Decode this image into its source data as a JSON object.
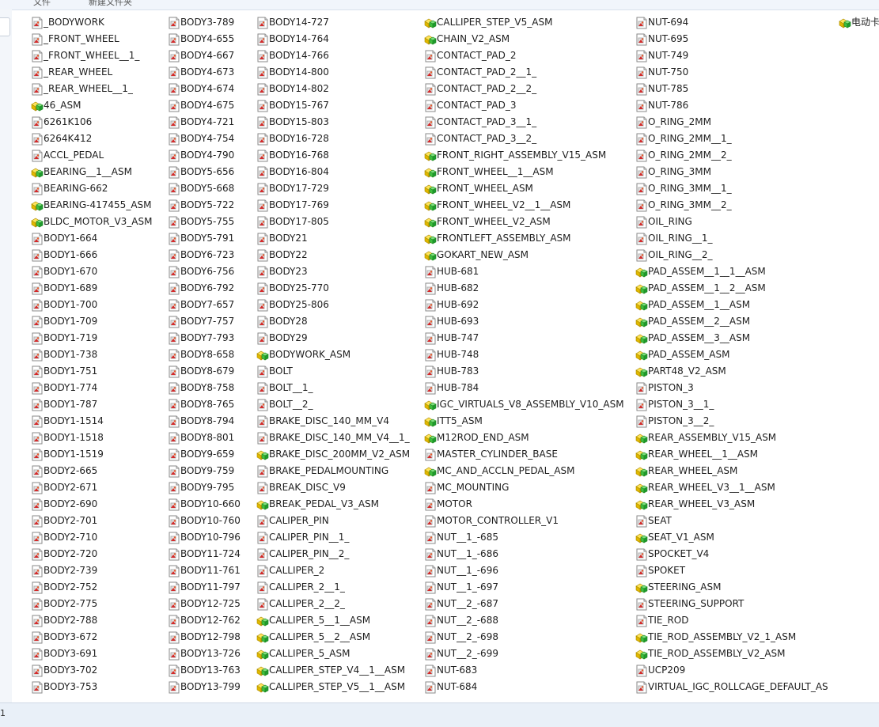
{
  "window": {
    "top_fragment_left": "文件",
    "top_fragment_right": "新建文件夹"
  },
  "status": {
    "text": "1"
  },
  "icons": {
    "part": "part-file-icon",
    "assembly": "assembly-file-icon"
  },
  "columns": [
    {
      "items": [
        {
          "name": "_BODYWORK",
          "type": "part"
        },
        {
          "name": "_FRONT_WHEEL",
          "type": "part"
        },
        {
          "name": "_FRONT_WHEEL__1_",
          "type": "part"
        },
        {
          "name": "_REAR_WHEEL",
          "type": "part"
        },
        {
          "name": "_REAR_WHEEL__1_",
          "type": "part"
        },
        {
          "name": "46_ASM",
          "type": "assembly"
        },
        {
          "name": "6261K106",
          "type": "part"
        },
        {
          "name": "6264K412",
          "type": "part"
        },
        {
          "name": "ACCL_PEDAL",
          "type": "part"
        },
        {
          "name": "BEARING__1__ASM",
          "type": "assembly"
        },
        {
          "name": "BEARING-662",
          "type": "part"
        },
        {
          "name": "BEARING-417455_ASM",
          "type": "assembly"
        },
        {
          "name": "BLDC_MOTOR_V3_ASM",
          "type": "assembly"
        },
        {
          "name": "BODY1-664",
          "type": "part"
        },
        {
          "name": "BODY1-666",
          "type": "part"
        },
        {
          "name": "BODY1-670",
          "type": "part"
        },
        {
          "name": "BODY1-689",
          "type": "part"
        },
        {
          "name": "BODY1-700",
          "type": "part"
        },
        {
          "name": "BODY1-709",
          "type": "part"
        },
        {
          "name": "BODY1-719",
          "type": "part"
        },
        {
          "name": "BODY1-738",
          "type": "part"
        },
        {
          "name": "BODY1-751",
          "type": "part"
        },
        {
          "name": "BODY1-774",
          "type": "part"
        },
        {
          "name": "BODY1-787",
          "type": "part"
        },
        {
          "name": "BODY1-1514",
          "type": "part"
        },
        {
          "name": "BODY1-1518",
          "type": "part"
        },
        {
          "name": "BODY1-1519",
          "type": "part"
        },
        {
          "name": "BODY2-665",
          "type": "part"
        },
        {
          "name": "BODY2-671",
          "type": "part"
        },
        {
          "name": "BODY2-690",
          "type": "part"
        },
        {
          "name": "BODY2-701",
          "type": "part"
        },
        {
          "name": "BODY2-710",
          "type": "part"
        },
        {
          "name": "BODY2-720",
          "type": "part"
        },
        {
          "name": "BODY2-739",
          "type": "part"
        },
        {
          "name": "BODY2-752",
          "type": "part"
        },
        {
          "name": "BODY2-775",
          "type": "part"
        },
        {
          "name": "BODY2-788",
          "type": "part"
        },
        {
          "name": "BODY3-672",
          "type": "part"
        },
        {
          "name": "BODY3-691",
          "type": "part"
        },
        {
          "name": "BODY3-702",
          "type": "part"
        },
        {
          "name": "BODY3-753",
          "type": "part"
        }
      ]
    },
    {
      "items": [
        {
          "name": "BODY3-789",
          "type": "part"
        },
        {
          "name": "BODY4-655",
          "type": "part"
        },
        {
          "name": "BODY4-667",
          "type": "part"
        },
        {
          "name": "BODY4-673",
          "type": "part"
        },
        {
          "name": "BODY4-674",
          "type": "part"
        },
        {
          "name": "BODY4-675",
          "type": "part"
        },
        {
          "name": "BODY4-721",
          "type": "part"
        },
        {
          "name": "BODY4-754",
          "type": "part"
        },
        {
          "name": "BODY4-790",
          "type": "part"
        },
        {
          "name": "BODY5-656",
          "type": "part"
        },
        {
          "name": "BODY5-668",
          "type": "part"
        },
        {
          "name": "BODY5-722",
          "type": "part"
        },
        {
          "name": "BODY5-755",
          "type": "part"
        },
        {
          "name": "BODY5-791",
          "type": "part"
        },
        {
          "name": "BODY6-723",
          "type": "part"
        },
        {
          "name": "BODY6-756",
          "type": "part"
        },
        {
          "name": "BODY6-792",
          "type": "part"
        },
        {
          "name": "BODY7-657",
          "type": "part"
        },
        {
          "name": "BODY7-757",
          "type": "part"
        },
        {
          "name": "BODY7-793",
          "type": "part"
        },
        {
          "name": "BODY8-658",
          "type": "part"
        },
        {
          "name": "BODY8-679",
          "type": "part"
        },
        {
          "name": "BODY8-758",
          "type": "part"
        },
        {
          "name": "BODY8-765",
          "type": "part"
        },
        {
          "name": "BODY8-794",
          "type": "part"
        },
        {
          "name": "BODY8-801",
          "type": "part"
        },
        {
          "name": "BODY9-659",
          "type": "part"
        },
        {
          "name": "BODY9-759",
          "type": "part"
        },
        {
          "name": "BODY9-795",
          "type": "part"
        },
        {
          "name": "BODY10-660",
          "type": "part"
        },
        {
          "name": "BODY10-760",
          "type": "part"
        },
        {
          "name": "BODY10-796",
          "type": "part"
        },
        {
          "name": "BODY11-724",
          "type": "part"
        },
        {
          "name": "BODY11-761",
          "type": "part"
        },
        {
          "name": "BODY11-797",
          "type": "part"
        },
        {
          "name": "BODY12-725",
          "type": "part"
        },
        {
          "name": "BODY12-762",
          "type": "part"
        },
        {
          "name": "BODY12-798",
          "type": "part"
        },
        {
          "name": "BODY13-726",
          "type": "part"
        },
        {
          "name": "BODY13-763",
          "type": "part"
        },
        {
          "name": "BODY13-799",
          "type": "part"
        }
      ]
    },
    {
      "items": [
        {
          "name": "BODY14-727",
          "type": "part"
        },
        {
          "name": "BODY14-764",
          "type": "part"
        },
        {
          "name": "BODY14-766",
          "type": "part"
        },
        {
          "name": "BODY14-800",
          "type": "part"
        },
        {
          "name": "BODY14-802",
          "type": "part"
        },
        {
          "name": "BODY15-767",
          "type": "part"
        },
        {
          "name": "BODY15-803",
          "type": "part"
        },
        {
          "name": "BODY16-728",
          "type": "part"
        },
        {
          "name": "BODY16-768",
          "type": "part"
        },
        {
          "name": "BODY16-804",
          "type": "part"
        },
        {
          "name": "BODY17-729",
          "type": "part"
        },
        {
          "name": "BODY17-769",
          "type": "part"
        },
        {
          "name": "BODY17-805",
          "type": "part"
        },
        {
          "name": "BODY21",
          "type": "part"
        },
        {
          "name": "BODY22",
          "type": "part"
        },
        {
          "name": "BODY23",
          "type": "part"
        },
        {
          "name": "BODY25-770",
          "type": "part"
        },
        {
          "name": "BODY25-806",
          "type": "part"
        },
        {
          "name": "BODY28",
          "type": "part"
        },
        {
          "name": "BODY29",
          "type": "part"
        },
        {
          "name": "BODYWORK_ASM",
          "type": "assembly"
        },
        {
          "name": "BOLT",
          "type": "part"
        },
        {
          "name": "BOLT__1_",
          "type": "part"
        },
        {
          "name": "BOLT__2_",
          "type": "part"
        },
        {
          "name": "BRAKE_DISC_140_MM_V4",
          "type": "part"
        },
        {
          "name": "BRAKE_DISC_140_MM_V4__1_",
          "type": "part"
        },
        {
          "name": "BRAKE_DISC_200MM_V2_ASM",
          "type": "assembly"
        },
        {
          "name": "BRAKE_PEDALMOUNTING",
          "type": "part"
        },
        {
          "name": "BREAK_DISC_V9",
          "type": "part"
        },
        {
          "name": "BREAK_PEDAL_V3_ASM",
          "type": "assembly"
        },
        {
          "name": "CALIPER_PIN",
          "type": "part"
        },
        {
          "name": "CALIPER_PIN__1_",
          "type": "part"
        },
        {
          "name": "CALIPER_PIN__2_",
          "type": "part"
        },
        {
          "name": "CALLIPER_2",
          "type": "part"
        },
        {
          "name": "CALLIPER_2__1_",
          "type": "part"
        },
        {
          "name": "CALLIPER_2__2_",
          "type": "part"
        },
        {
          "name": "CALLIPER_5__1__ASM",
          "type": "assembly"
        },
        {
          "name": "CALLIPER_5__2__ASM",
          "type": "assembly"
        },
        {
          "name": "CALLIPER_5_ASM",
          "type": "assembly"
        },
        {
          "name": "CALLIPER_STEP_V4__1__ASM",
          "type": "assembly"
        },
        {
          "name": "CALLIPER_STEP_V5__1__ASM",
          "type": "assembly"
        }
      ]
    },
    {
      "items": [
        {
          "name": "CALLIPER_STEP_V5_ASM",
          "type": "assembly"
        },
        {
          "name": "CHAIN_V2_ASM",
          "type": "assembly"
        },
        {
          "name": "CONTACT_PAD_2",
          "type": "part"
        },
        {
          "name": "CONTACT_PAD_2__1_",
          "type": "part"
        },
        {
          "name": "CONTACT_PAD_2__2_",
          "type": "part"
        },
        {
          "name": "CONTACT_PAD_3",
          "type": "part"
        },
        {
          "name": "CONTACT_PAD_3__1_",
          "type": "part"
        },
        {
          "name": "CONTACT_PAD_3__2_",
          "type": "part"
        },
        {
          "name": "FRONT_RIGHT_ASSEMBLY_V15_ASM",
          "type": "assembly"
        },
        {
          "name": "FRONT_WHEEL__1__ASM",
          "type": "assembly"
        },
        {
          "name": "FRONT_WHEEL_ASM",
          "type": "assembly"
        },
        {
          "name": "FRONT_WHEEL_V2__1__ASM",
          "type": "assembly"
        },
        {
          "name": "FRONT_WHEEL_V2_ASM",
          "type": "assembly"
        },
        {
          "name": "FRONTLEFT_ASSEMBLY_ASM",
          "type": "assembly"
        },
        {
          "name": "GOKART_NEW_ASM",
          "type": "assembly"
        },
        {
          "name": "HUB-681",
          "type": "part"
        },
        {
          "name": "HUB-682",
          "type": "part"
        },
        {
          "name": "HUB-692",
          "type": "part"
        },
        {
          "name": "HUB-693",
          "type": "part"
        },
        {
          "name": "HUB-747",
          "type": "part"
        },
        {
          "name": "HUB-748",
          "type": "part"
        },
        {
          "name": "HUB-783",
          "type": "part"
        },
        {
          "name": "HUB-784",
          "type": "part"
        },
        {
          "name": "IGC_VIRTUALS_V8_ASSEMBLY_V10_ASM",
          "type": "assembly"
        },
        {
          "name": "ITT5_ASM",
          "type": "assembly"
        },
        {
          "name": "M12ROD_END_ASM",
          "type": "assembly"
        },
        {
          "name": "MASTER_CYLINDER_BASE",
          "type": "part"
        },
        {
          "name": "MC_AND_ACCLN_PEDAL_ASM",
          "type": "assembly"
        },
        {
          "name": "MC_MOUNTING",
          "type": "part"
        },
        {
          "name": "MOTOR",
          "type": "part"
        },
        {
          "name": "MOTOR_CONTROLLER_V1",
          "type": "part"
        },
        {
          "name": "NUT__1_-685",
          "type": "part"
        },
        {
          "name": "NUT__1_-686",
          "type": "part"
        },
        {
          "name": "NUT__1_-696",
          "type": "part"
        },
        {
          "name": "NUT__1_-697",
          "type": "part"
        },
        {
          "name": "NUT__2_-687",
          "type": "part"
        },
        {
          "name": "NUT__2_-688",
          "type": "part"
        },
        {
          "name": "NUT__2_-698",
          "type": "part"
        },
        {
          "name": "NUT__2_-699",
          "type": "part"
        },
        {
          "name": "NUT-683",
          "type": "part"
        },
        {
          "name": "NUT-684",
          "type": "part"
        }
      ]
    },
    {
      "items": [
        {
          "name": "NUT-694",
          "type": "part"
        },
        {
          "name": "NUT-695",
          "type": "part"
        },
        {
          "name": "NUT-749",
          "type": "part"
        },
        {
          "name": "NUT-750",
          "type": "part"
        },
        {
          "name": "NUT-785",
          "type": "part"
        },
        {
          "name": "NUT-786",
          "type": "part"
        },
        {
          "name": "O_RING_2MM",
          "type": "part"
        },
        {
          "name": "O_RING_2MM__1_",
          "type": "part"
        },
        {
          "name": "O_RING_2MM__2_",
          "type": "part"
        },
        {
          "name": "O_RING_3MM",
          "type": "part"
        },
        {
          "name": "O_RING_3MM__1_",
          "type": "part"
        },
        {
          "name": "O_RING_3MM__2_",
          "type": "part"
        },
        {
          "name": "OIL_RING",
          "type": "part"
        },
        {
          "name": "OIL_RING__1_",
          "type": "part"
        },
        {
          "name": "OIL_RING__2_",
          "type": "part"
        },
        {
          "name": "PAD_ASSEM__1__1__ASM",
          "type": "assembly"
        },
        {
          "name": "PAD_ASSEM__1__2__ASM",
          "type": "assembly"
        },
        {
          "name": "PAD_ASSEM__1__ASM",
          "type": "assembly"
        },
        {
          "name": "PAD_ASSEM__2__ASM",
          "type": "assembly"
        },
        {
          "name": "PAD_ASSEM__3__ASM",
          "type": "assembly"
        },
        {
          "name": "PAD_ASSEM_ASM",
          "type": "assembly"
        },
        {
          "name": "PART48_V2_ASM",
          "type": "assembly"
        },
        {
          "name": "PISTON_3",
          "type": "part"
        },
        {
          "name": "PISTON_3__1_",
          "type": "part"
        },
        {
          "name": "PISTON_3__2_",
          "type": "part"
        },
        {
          "name": "REAR_ASSEMBLY_V15_ASM",
          "type": "assembly"
        },
        {
          "name": "REAR_WHEEL__1__ASM",
          "type": "assembly"
        },
        {
          "name": "REAR_WHEEL_ASM",
          "type": "assembly"
        },
        {
          "name": "REAR_WHEEL_V3__1__ASM",
          "type": "assembly"
        },
        {
          "name": "REAR_WHEEL_V3_ASM",
          "type": "assembly"
        },
        {
          "name": "SEAT",
          "type": "part"
        },
        {
          "name": "SEAT_V1_ASM",
          "type": "assembly"
        },
        {
          "name": "SPOCKET_V4",
          "type": "part"
        },
        {
          "name": "SPOKET",
          "type": "part"
        },
        {
          "name": "STEERING_ASM",
          "type": "assembly"
        },
        {
          "name": "STEERING_SUPPORT",
          "type": "part"
        },
        {
          "name": "TIE_ROD",
          "type": "part"
        },
        {
          "name": "TIE_ROD_ASSEMBLY_V2_1_ASM",
          "type": "assembly"
        },
        {
          "name": "TIE_ROD_ASSEMBLY_V2_ASM",
          "type": "assembly"
        },
        {
          "name": "UCP209",
          "type": "part"
        },
        {
          "name": "VIRTUAL_IGC_ROLLCAGE_DEFAULT_AS",
          "type": "part"
        }
      ]
    },
    {
      "items": [
        {
          "name": "电动卡",
          "type": "assembly"
        }
      ]
    }
  ]
}
